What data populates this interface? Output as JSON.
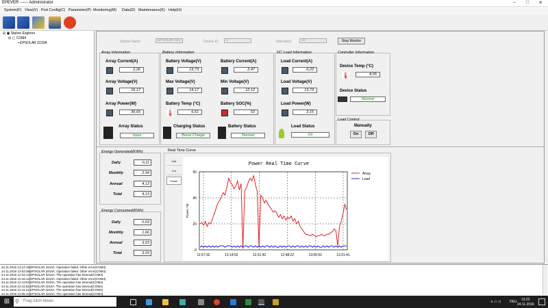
{
  "window": {
    "title": "EPEVER ------ Administrator",
    "minimize": "–",
    "maximize": "□",
    "close": "✕"
  },
  "menu": [
    "System(F)",
    "View(V)",
    "Port Config(C)",
    "Parameter(P)",
    "Monitoring(M)",
    "Data(D)",
    "Maintenance(K)",
    "Help(H)"
  ],
  "tree": {
    "root": "Station Explorer",
    "port": "COM4",
    "device": "EPSOLAR 3210A"
  },
  "header": {
    "station_label": "Station Name",
    "station_value": "EPSOLAR 321",
    "device_label": "Device ID",
    "device_value": "1",
    "interval_label": "Interval(s)",
    "interval_value": "10",
    "stop_button": "Stop Monitor"
  },
  "array": {
    "title": "Array Information",
    "current_label": "Array Current(A)",
    "current": "2,26",
    "voltage_label": "Array Voltage(V)",
    "voltage": "16,17",
    "power_label": "Array Power(W)",
    "power": "36,65",
    "status_label": "Array Status",
    "status": "Input"
  },
  "battery": {
    "title": "Battery Information",
    "voltage_label": "Battery Voltage(V)",
    "voltage": "13,73",
    "current_label": "Battery Current(A)",
    "current": "2,47",
    "max_label": "Max Voltage(V)",
    "max": "14,17",
    "min_label": "Min Voltage(V)",
    "min": "12,12",
    "temp_label": "Battery Temp (°C)",
    "temp": "6,61",
    "soc_label": "Battery SOC(%)",
    "soc": "53",
    "charging_label": "Charging Status",
    "charging": "Boost Charge",
    "status_label": "Battery Status",
    "status": "Normal"
  },
  "load": {
    "title": "DC Load Information",
    "current_label": "Load Current(A)",
    "current": "0,23",
    "voltage_label": "Load Voltage(V)",
    "voltage": "13,73",
    "power_label": "Load Power(W)",
    "power": "3,15",
    "status_label": "Load Status",
    "status": "On"
  },
  "controller": {
    "title": "Controller Information",
    "temp_label": "Device Temp (°C)",
    "temp": "8,05",
    "status_label": "Device Status",
    "status": "Normal"
  },
  "load_control": {
    "title": "Load Control",
    "manual_label": "Manually",
    "on_button": "On",
    "off_button": "Off"
  },
  "energy_generated": {
    "title": "Energy Generated(KWh)",
    "rows": [
      {
        "label": "Daily",
        "value": "0,11"
      },
      {
        "label": "Monthly",
        "value": "2,54"
      },
      {
        "label": "Annual",
        "value": "4,13"
      },
      {
        "label": "Total",
        "value": "4,13"
      }
    ]
  },
  "energy_consumed": {
    "title": "Energy Consumed(KWh)",
    "rows": [
      {
        "label": "Daily",
        "value": "0,03"
      },
      {
        "label": "Monthly",
        "value": "1,66"
      },
      {
        "label": "Annual",
        "value": "3,03"
      },
      {
        "label": "Total",
        "value": "3,03"
      }
    ]
  },
  "realtime": {
    "title": "Real Time Curve",
    "tabs": [
      "Volt",
      "Cur",
      "Power"
    ]
  },
  "chart_data": {
    "type": "line",
    "title": "Power Real Time Curve",
    "ylabel": "Power / W",
    "ylim": [
      0,
      60
    ],
    "yticks": [
      0,
      20,
      40,
      60
    ],
    "xticks": [
      "11:57:32",
      "12:14:52",
      "12:31:42",
      "12:48:22",
      "13:05:02",
      "13:21:41"
    ],
    "grid": true,
    "legend": "top-right",
    "series": [
      {
        "name": "Array",
        "color": "#e02020",
        "values": [
          20,
          21,
          19,
          22,
          18,
          21,
          20,
          24,
          28,
          32,
          36,
          38,
          41,
          44,
          42,
          48,
          55,
          52,
          50,
          47,
          49,
          53,
          46,
          51,
          1,
          45,
          48,
          52,
          55,
          53,
          57,
          50,
          45,
          2,
          42,
          40,
          36,
          38,
          35,
          33,
          31,
          29,
          30,
          28,
          25,
          27,
          24,
          26,
          23,
          25,
          24,
          26,
          22,
          24,
          20,
          22,
          18,
          16,
          14,
          12,
          12,
          11,
          11,
          12,
          11,
          10,
          11,
          11,
          12,
          11,
          11,
          12,
          12,
          13,
          14,
          16,
          15,
          3,
          18,
          22,
          28,
          35,
          31
        ]
      },
      {
        "name": "Load",
        "color": "#2020d0",
        "values": [
          2,
          3,
          2,
          3,
          2,
          3,
          2,
          3,
          2,
          3,
          2,
          3,
          3,
          3,
          2,
          3,
          3,
          3,
          2,
          3,
          2,
          3,
          2,
          3,
          2,
          3,
          3,
          2,
          3,
          3,
          2,
          3,
          2,
          3,
          2,
          3,
          2,
          3,
          3,
          2,
          3,
          2,
          3,
          2,
          2,
          3,
          2,
          3,
          2,
          3,
          3,
          2,
          3,
          2,
          3,
          3,
          2,
          3,
          2,
          3,
          2,
          3,
          3,
          2,
          3,
          2,
          3,
          2,
          2,
          3,
          2,
          3,
          2,
          3,
          3,
          2,
          3,
          2,
          3,
          2,
          3,
          3,
          3
        ]
      }
    ]
  },
  "log": [
    "24.11.2016 13:14:15[EPSOLAR 3210A: Operation failed. Other error(COM4)",
    "24.11.2016 12:52:36[EPSOLAR 3210A: Operation failed. Other error(COM4)",
    "24.11.2016 12:22:14[EPSOLAR 3210A: The operation has timeout(COM4)",
    "24.11.2016 12:15:12[EPSOLAR 3210A: Operation failed. Other error(COM4)",
    "24.11.2016 12:13:52[EPSOLAR 3210A: The operation has timeout(COM4)",
    "24.11.2016 12:11:52[EPSOLAR 3210A: The operation has timeout(COM4)",
    "24.11.2016 12:11:21[EPSOLAR 3210A: The operation has timeout(COM4)",
    "24.11.2016 12:05:13[EPSOLAR 3210A: The operation has timeout(COM4)"
  ],
  "taskbar": {
    "search_placeholder": "Frag mich etwas",
    "lang": "DEU",
    "time": "13:22",
    "date": "24.11.2016"
  }
}
